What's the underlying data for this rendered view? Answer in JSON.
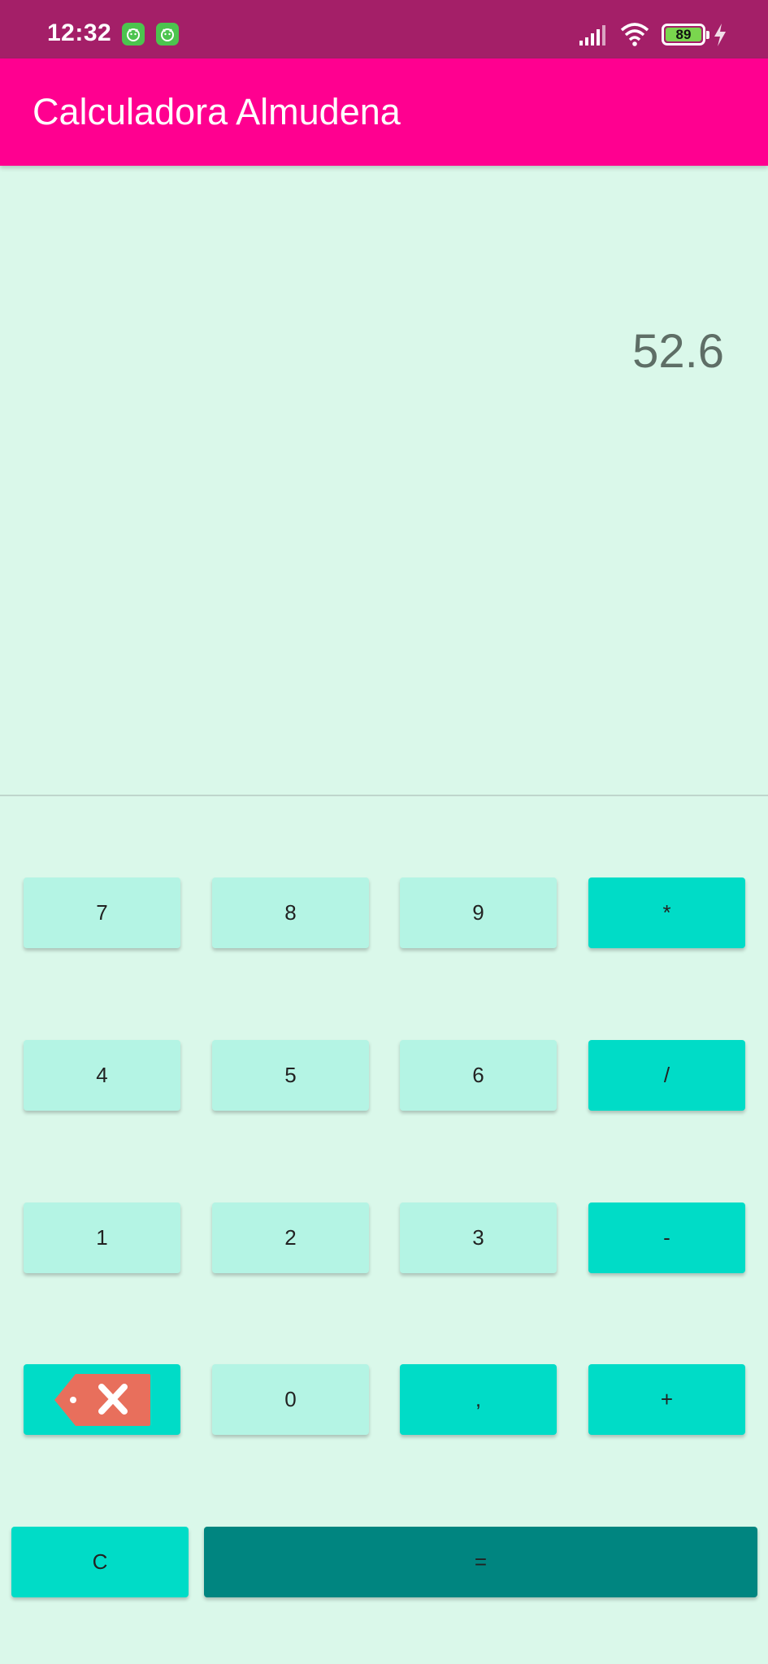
{
  "status_bar": {
    "time": "12:32",
    "battery": "89",
    "icons": [
      "app-notification-icon",
      "app-notification-icon",
      "signal-icon",
      "wifi-icon",
      "battery-icon",
      "charging-bolt-icon"
    ]
  },
  "app_bar": {
    "title": "Calculadora Almudena",
    "color": "#FF0090"
  },
  "display": {
    "value": "52.6"
  },
  "keypad": {
    "row1": [
      "7",
      "8",
      "9",
      "*"
    ],
    "row2": [
      "4",
      "5",
      "6",
      "/"
    ],
    "row3": [
      "1",
      "2",
      "3",
      "-"
    ],
    "row4": [
      "backspace-icon",
      "0",
      ",",
      "+"
    ],
    "row5": [
      "C",
      "="
    ],
    "colors": {
      "number": "#B4F4E4",
      "operator": "#00DCC7",
      "equals": "#008580",
      "backspace": "#E86F5C"
    }
  }
}
